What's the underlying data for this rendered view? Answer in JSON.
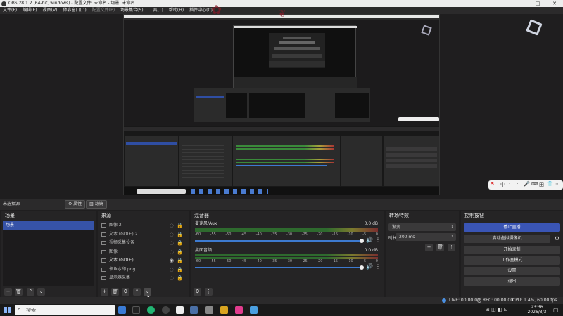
{
  "window": {
    "title": "OBS 28.1.2 (64-bit, windows) - 配置文件: 未命名 - 场景: 未命名",
    "minimize": "–",
    "maximize": "□",
    "close": "✕"
  },
  "menu": [
    "文件(F)",
    "编辑(E)",
    "视图(V)",
    "停靠窗口(D)",
    "配置文件(P)",
    "场景集合(S)",
    "工具(T)",
    "帮助(H)",
    "插件中心(C)"
  ],
  "preview_toolbar": {
    "label": "未选择源",
    "properties": "属性",
    "filters": "滤镜"
  },
  "scenes": {
    "title": "场景",
    "items": [
      "场景"
    ]
  },
  "sources": {
    "title": "来源",
    "items": [
      {
        "name": "图像 2",
        "visible": false
      },
      {
        "name": "文本 (GDI+) 2",
        "visible": false
      },
      {
        "name": "视频采集设备",
        "visible": false
      },
      {
        "name": "图像",
        "visible": false
      },
      {
        "name": "文本 (GDI+)",
        "visible": true
      },
      {
        "name": "卡鱼水印.png",
        "visible": false
      },
      {
        "name": "显示器采集",
        "visible": false
      }
    ]
  },
  "mixer": {
    "title": "混音器",
    "channels": [
      {
        "name": "麦克风/Aux",
        "db": "0.0 dB",
        "volume": 1.0
      },
      {
        "name": "桌面音频",
        "db": "0.0 dB",
        "volume": 1.0
      }
    ],
    "ticks": [
      "-60",
      "-55",
      "-50",
      "-45",
      "-40",
      "-35",
      "-30",
      "-25",
      "-20",
      "-15",
      "-10",
      "-5",
      "0"
    ]
  },
  "transitions": {
    "title": "转场特效",
    "type": "渐变",
    "duration_label": "时长",
    "duration_value": "200 ms"
  },
  "controls": {
    "title": "控制按钮",
    "buttons": [
      "停止直播",
      "启动虚拟摄像机",
      "开始录制",
      "工作室模式",
      "设置",
      "退出"
    ]
  },
  "statusbar": {
    "live": "LIVE: 00:00:00",
    "rec": "REC: 00:00:00",
    "cpu": "CPU: 1.4%, 60.00 fps"
  },
  "taskbar": {
    "search_placeholder": "搜索",
    "time": "23:36",
    "date": "2026/3/3"
  },
  "ime": {
    "items": [
      "中",
      "·",
      "·",
      "🎤",
      "⌨",
      "田",
      "👕",
      "⋯"
    ]
  },
  "colors": {
    "accent": "#3a55b5",
    "panel": "#252425",
    "bg": "#1f1e1f"
  }
}
